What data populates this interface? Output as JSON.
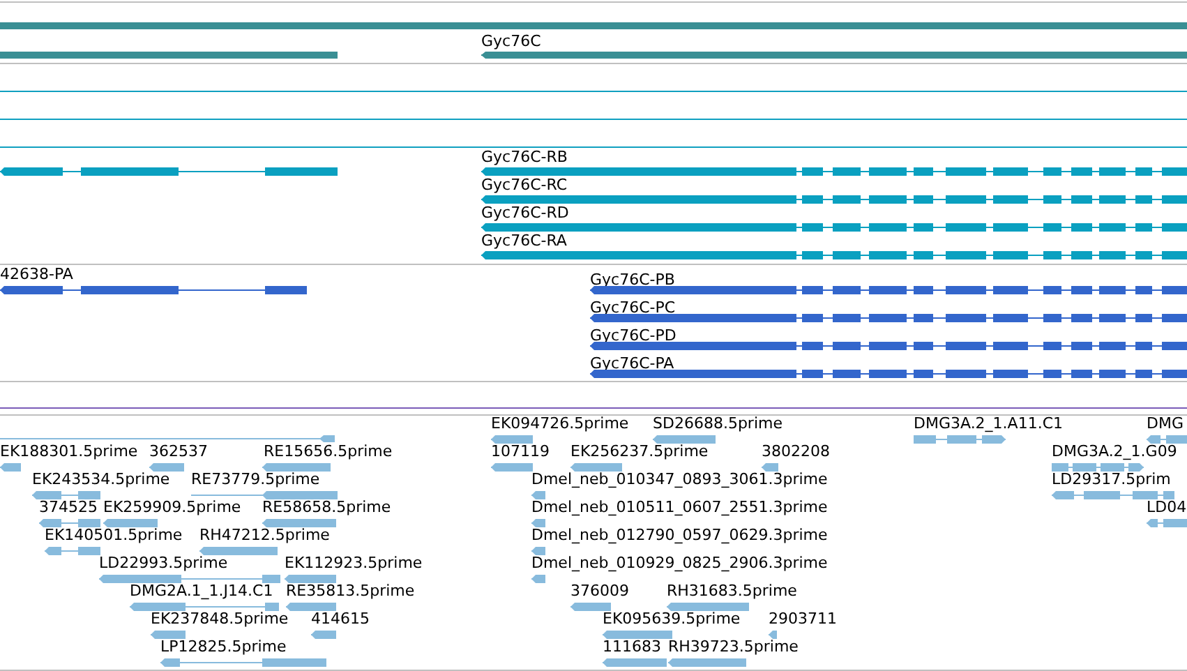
{
  "gene_track": {
    "features": [
      {
        "label": "Gyc76C"
      }
    ]
  },
  "transcript_track": {
    "features": [
      {
        "label": "Gyc76C-RB"
      },
      {
        "label": "Gyc76C-RC"
      },
      {
        "label": "Gyc76C-RD"
      },
      {
        "label": "Gyc76C-RA"
      }
    ]
  },
  "protein_track": {
    "features": [
      {
        "label": "42638-PA"
      },
      {
        "label": "Gyc76C-PB"
      },
      {
        "label": "Gyc76C-PC"
      },
      {
        "label": "Gyc76C-PD"
      },
      {
        "label": "Gyc76C-PA"
      }
    ]
  },
  "est_track": {
    "features": [
      {
        "label": "EK188301.5prime"
      },
      {
        "label": "362537"
      },
      {
        "label": "RE15656.5prime"
      },
      {
        "label": "EK243534.5prime"
      },
      {
        "label": "RE73779.5prime"
      },
      {
        "label": "374525"
      },
      {
        "label": "EK259909.5prime"
      },
      {
        "label": "RE58658.5prime"
      },
      {
        "label": "EK140501.5prime"
      },
      {
        "label": "RH47212.5prime"
      },
      {
        "label": "LD22993.5prime"
      },
      {
        "label": "EK112923.5prime"
      },
      {
        "label": "DMG2A.1_1.J14.C1"
      },
      {
        "label": "RE35813.5prime"
      },
      {
        "label": "EK237848.5prime"
      },
      {
        "label": "414615"
      },
      {
        "label": "LP12825.5prime"
      },
      {
        "label": "EK094726.5prime"
      },
      {
        "label": "SD26688.5prime"
      },
      {
        "label": "107119"
      },
      {
        "label": "EK256237.5prime"
      },
      {
        "label": "3802208"
      },
      {
        "label": "Dmel_neb_010347_0893_3061.3prime"
      },
      {
        "label": "Dmel_neb_010511_0607_2551.3prime"
      },
      {
        "label": "Dmel_neb_012790_0597_0629.3prime"
      },
      {
        "label": "Dmel_neb_010929_0825_2906.3prime"
      },
      {
        "label": "376009"
      },
      {
        "label": "RH31683.5prime"
      },
      {
        "label": "EK095639.5prime"
      },
      {
        "label": "2903711"
      },
      {
        "label": "111683"
      },
      {
        "label": "RH39723.5prime"
      },
      {
        "label": "DMG3A.2_1.A11.C1"
      },
      {
        "label": "DMG"
      },
      {
        "label": "DMG3A.2_1.G09"
      },
      {
        "label": "LD29317.5prim"
      },
      {
        "label": "LD04"
      }
    ]
  }
}
